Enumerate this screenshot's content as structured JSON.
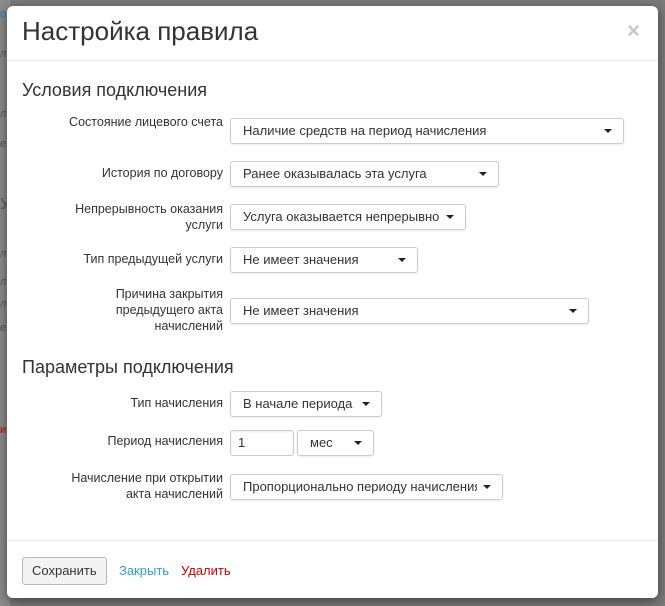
{
  "background": {
    "fragments": [
      "о",
      "л",
      "л",
      "е",
      "У",
      "л",
      "л",
      "л",
      "е",
      "и"
    ]
  },
  "modal": {
    "title": "Настройка правила",
    "close_symbol": "×"
  },
  "connection_conditions": {
    "title": "Условия подключения",
    "account_state": {
      "label": "Состояние лицевого счета",
      "value": "Наличие средств на период начисления"
    },
    "contract_history": {
      "label": "История по договору",
      "value": "Ранее оказывалась эта услуга"
    },
    "service_continuity": {
      "label": "Непрерывность оказания услуги",
      "value": "Услуга оказывается непрерывно"
    },
    "previous_service_type": {
      "label": "Тип предыдущей услуги",
      "value": "Не имеет значения"
    },
    "previous_act_closing_reason": {
      "label": "Причина закрытия предыдущего акта начислений",
      "value": "Не имеет значения"
    }
  },
  "connection_parameters": {
    "title": "Параметры подключения",
    "charge_type": {
      "label": "Тип начисления",
      "value": "В начале периода"
    },
    "charge_period": {
      "label": "Период начисления",
      "number": "1",
      "unit": "мес"
    },
    "charge_on_open": {
      "label": "Начисление при открытии акта начислений",
      "value": "Пропорционально периоду начисления"
    }
  },
  "footer": {
    "save_label": "Сохранить",
    "close_label": "Закрыть",
    "delete_label": "Удалить"
  },
  "colors": {
    "link": "#2a9fd6",
    "danger": "#cc0000",
    "overlay": "#7b7b7b"
  }
}
